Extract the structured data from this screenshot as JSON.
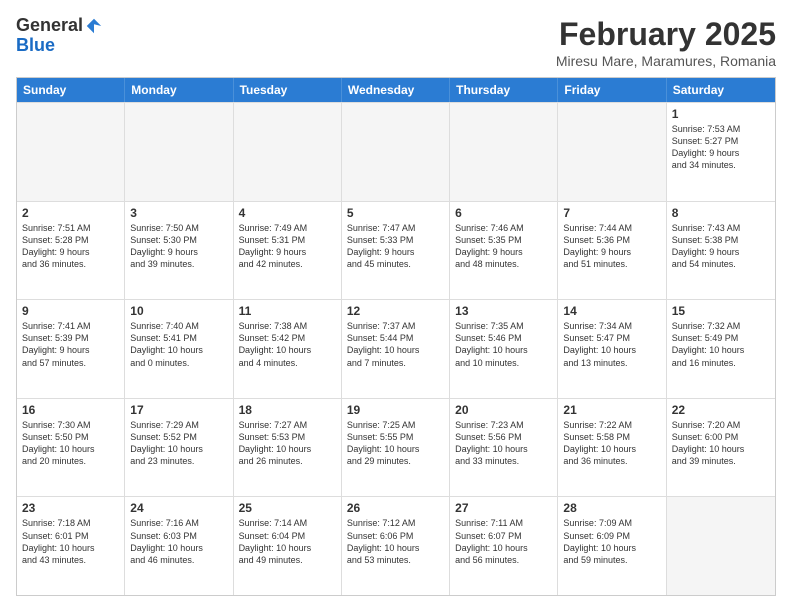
{
  "logo": {
    "line1": "General",
    "line2": "Blue"
  },
  "header": {
    "title": "February 2025",
    "subtitle": "Miresu Mare, Maramures, Romania"
  },
  "days": [
    "Sunday",
    "Monday",
    "Tuesday",
    "Wednesday",
    "Thursday",
    "Friday",
    "Saturday"
  ],
  "rows": [
    [
      {
        "day": "",
        "empty": true
      },
      {
        "day": "",
        "empty": true
      },
      {
        "day": "",
        "empty": true
      },
      {
        "day": "",
        "empty": true
      },
      {
        "day": "",
        "empty": true
      },
      {
        "day": "",
        "empty": true
      },
      {
        "day": "1",
        "lines": [
          "Sunrise: 7:53 AM",
          "Sunset: 5:27 PM",
          "Daylight: 9 hours",
          "and 34 minutes."
        ]
      }
    ],
    [
      {
        "day": "2",
        "lines": [
          "Sunrise: 7:51 AM",
          "Sunset: 5:28 PM",
          "Daylight: 9 hours",
          "and 36 minutes."
        ]
      },
      {
        "day": "3",
        "lines": [
          "Sunrise: 7:50 AM",
          "Sunset: 5:30 PM",
          "Daylight: 9 hours",
          "and 39 minutes."
        ]
      },
      {
        "day": "4",
        "lines": [
          "Sunrise: 7:49 AM",
          "Sunset: 5:31 PM",
          "Daylight: 9 hours",
          "and 42 minutes."
        ]
      },
      {
        "day": "5",
        "lines": [
          "Sunrise: 7:47 AM",
          "Sunset: 5:33 PM",
          "Daylight: 9 hours",
          "and 45 minutes."
        ]
      },
      {
        "day": "6",
        "lines": [
          "Sunrise: 7:46 AM",
          "Sunset: 5:35 PM",
          "Daylight: 9 hours",
          "and 48 minutes."
        ]
      },
      {
        "day": "7",
        "lines": [
          "Sunrise: 7:44 AM",
          "Sunset: 5:36 PM",
          "Daylight: 9 hours",
          "and 51 minutes."
        ]
      },
      {
        "day": "8",
        "lines": [
          "Sunrise: 7:43 AM",
          "Sunset: 5:38 PM",
          "Daylight: 9 hours",
          "and 54 minutes."
        ]
      }
    ],
    [
      {
        "day": "9",
        "lines": [
          "Sunrise: 7:41 AM",
          "Sunset: 5:39 PM",
          "Daylight: 9 hours",
          "and 57 minutes."
        ]
      },
      {
        "day": "10",
        "lines": [
          "Sunrise: 7:40 AM",
          "Sunset: 5:41 PM",
          "Daylight: 10 hours",
          "and 0 minutes."
        ]
      },
      {
        "day": "11",
        "lines": [
          "Sunrise: 7:38 AM",
          "Sunset: 5:42 PM",
          "Daylight: 10 hours",
          "and 4 minutes."
        ]
      },
      {
        "day": "12",
        "lines": [
          "Sunrise: 7:37 AM",
          "Sunset: 5:44 PM",
          "Daylight: 10 hours",
          "and 7 minutes."
        ]
      },
      {
        "day": "13",
        "lines": [
          "Sunrise: 7:35 AM",
          "Sunset: 5:46 PM",
          "Daylight: 10 hours",
          "and 10 minutes."
        ]
      },
      {
        "day": "14",
        "lines": [
          "Sunrise: 7:34 AM",
          "Sunset: 5:47 PM",
          "Daylight: 10 hours",
          "and 13 minutes."
        ]
      },
      {
        "day": "15",
        "lines": [
          "Sunrise: 7:32 AM",
          "Sunset: 5:49 PM",
          "Daylight: 10 hours",
          "and 16 minutes."
        ]
      }
    ],
    [
      {
        "day": "16",
        "lines": [
          "Sunrise: 7:30 AM",
          "Sunset: 5:50 PM",
          "Daylight: 10 hours",
          "and 20 minutes."
        ]
      },
      {
        "day": "17",
        "lines": [
          "Sunrise: 7:29 AM",
          "Sunset: 5:52 PM",
          "Daylight: 10 hours",
          "and 23 minutes."
        ]
      },
      {
        "day": "18",
        "lines": [
          "Sunrise: 7:27 AM",
          "Sunset: 5:53 PM",
          "Daylight: 10 hours",
          "and 26 minutes."
        ]
      },
      {
        "day": "19",
        "lines": [
          "Sunrise: 7:25 AM",
          "Sunset: 5:55 PM",
          "Daylight: 10 hours",
          "and 29 minutes."
        ]
      },
      {
        "day": "20",
        "lines": [
          "Sunrise: 7:23 AM",
          "Sunset: 5:56 PM",
          "Daylight: 10 hours",
          "and 33 minutes."
        ]
      },
      {
        "day": "21",
        "lines": [
          "Sunrise: 7:22 AM",
          "Sunset: 5:58 PM",
          "Daylight: 10 hours",
          "and 36 minutes."
        ]
      },
      {
        "day": "22",
        "lines": [
          "Sunrise: 7:20 AM",
          "Sunset: 6:00 PM",
          "Daylight: 10 hours",
          "and 39 minutes."
        ]
      }
    ],
    [
      {
        "day": "23",
        "lines": [
          "Sunrise: 7:18 AM",
          "Sunset: 6:01 PM",
          "Daylight: 10 hours",
          "and 43 minutes."
        ]
      },
      {
        "day": "24",
        "lines": [
          "Sunrise: 7:16 AM",
          "Sunset: 6:03 PM",
          "Daylight: 10 hours",
          "and 46 minutes."
        ]
      },
      {
        "day": "25",
        "lines": [
          "Sunrise: 7:14 AM",
          "Sunset: 6:04 PM",
          "Daylight: 10 hours",
          "and 49 minutes."
        ]
      },
      {
        "day": "26",
        "lines": [
          "Sunrise: 7:12 AM",
          "Sunset: 6:06 PM",
          "Daylight: 10 hours",
          "and 53 minutes."
        ]
      },
      {
        "day": "27",
        "lines": [
          "Sunrise: 7:11 AM",
          "Sunset: 6:07 PM",
          "Daylight: 10 hours",
          "and 56 minutes."
        ]
      },
      {
        "day": "28",
        "lines": [
          "Sunrise: 7:09 AM",
          "Sunset: 6:09 PM",
          "Daylight: 10 hours",
          "and 59 minutes."
        ]
      },
      {
        "day": "",
        "empty": true
      }
    ]
  ]
}
